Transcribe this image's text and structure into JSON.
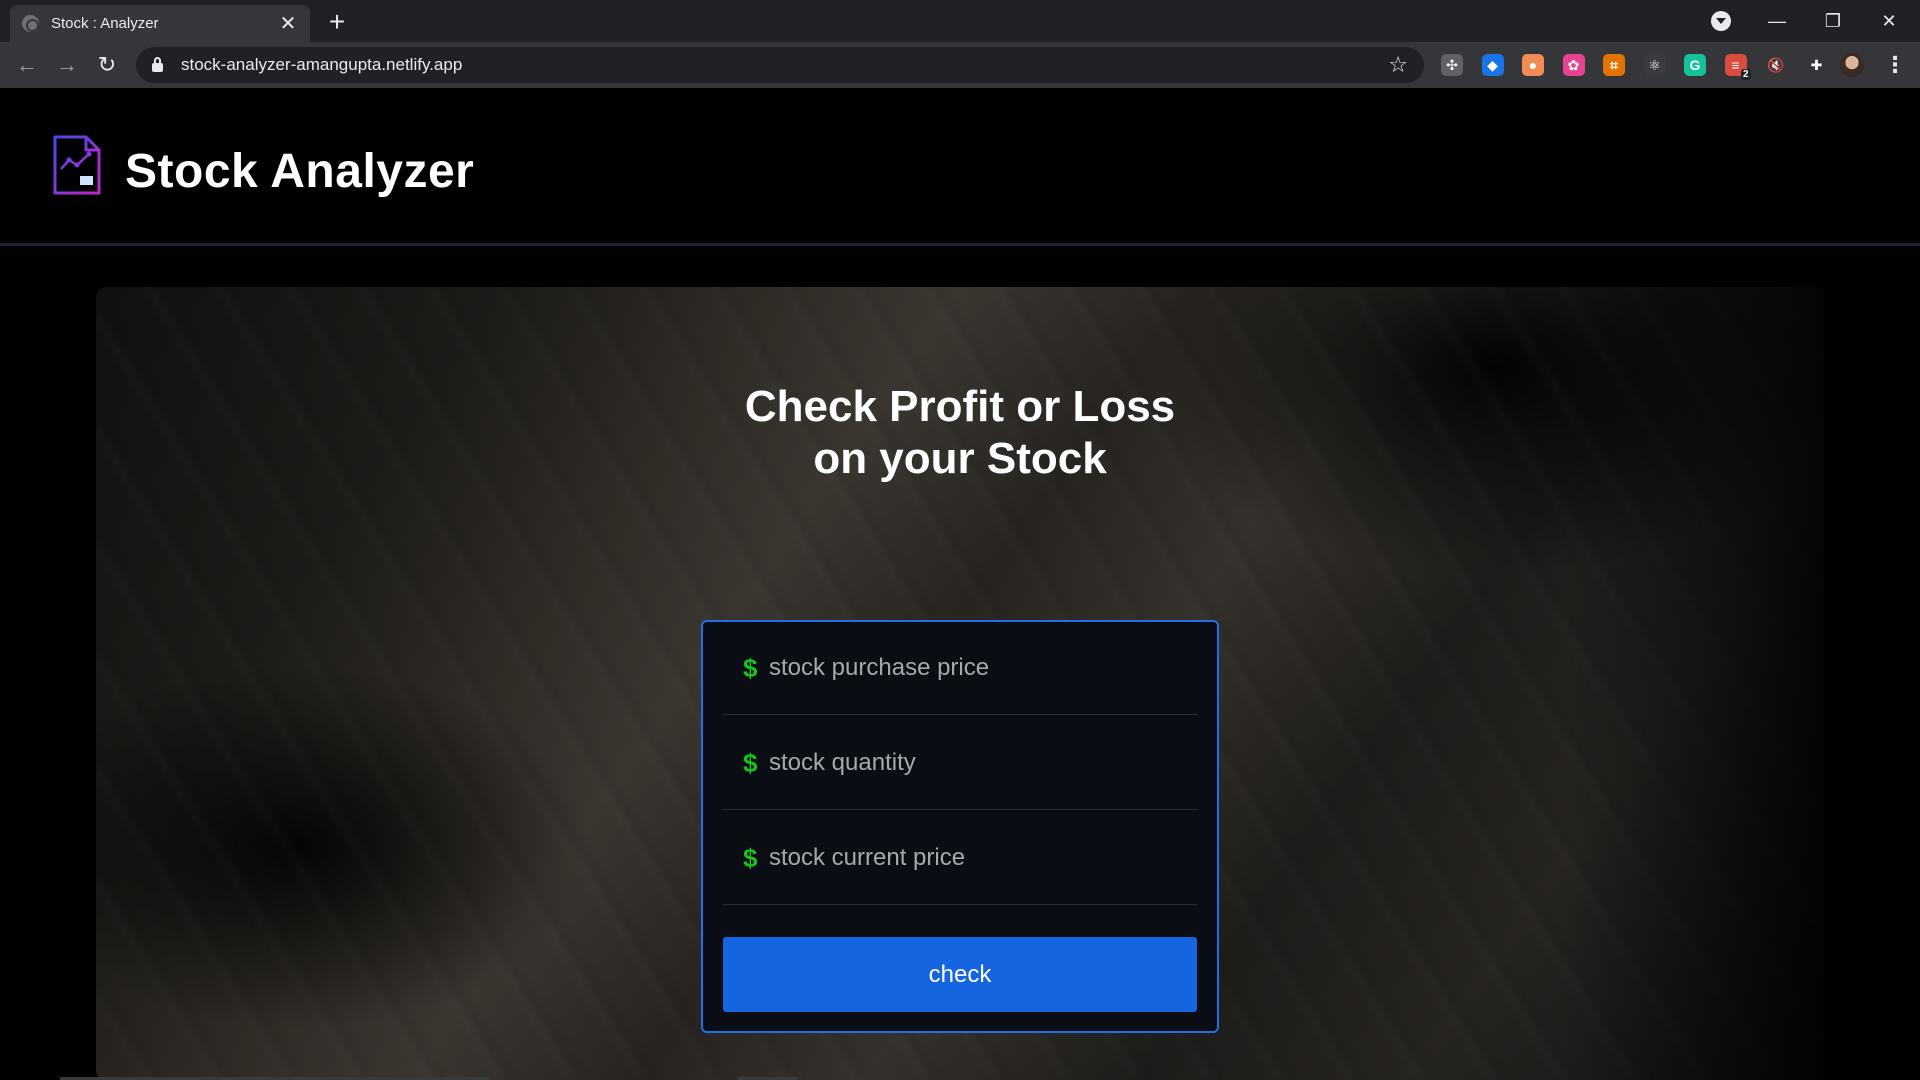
{
  "browser": {
    "tab_title": "Stock : Analyzer",
    "tab_close": "✕",
    "new_tab": "+",
    "url": "stock-analyzer-amangupta.netlify.app",
    "nav": {
      "back": "←",
      "forward": "→",
      "reload": "↻"
    },
    "window": {
      "minimize": "—",
      "restore": "❐",
      "close": "✕"
    },
    "extensions": [
      {
        "name": "extension-grid-icon",
        "symbol": "✣",
        "color": "#5f6368"
      },
      {
        "name": "extension-droplet-icon",
        "symbol": "◆",
        "color": "#1a73e8"
      },
      {
        "name": "extension-pill-icon",
        "symbol": "●",
        "color": "#f28b54"
      },
      {
        "name": "extension-color-wheel-icon",
        "symbol": "✿",
        "color": "#e84393"
      },
      {
        "name": "extension-capture-icon",
        "symbol": "⌗",
        "color": "#e37400"
      },
      {
        "name": "extension-react-icon",
        "symbol": "⚛",
        "color": "#3a3b3f"
      },
      {
        "name": "extension-grammarly-icon",
        "symbol": "G",
        "color": "#15c39a"
      },
      {
        "name": "extension-todoist-icon",
        "symbol": "≡",
        "color": "#db4c3f",
        "badge": "2"
      },
      {
        "name": "extension-mute-icon",
        "symbol": "🔇",
        "color": "#35363a"
      },
      {
        "name": "extensions-puzzle-icon",
        "symbol": "✚",
        "color": "#35363a"
      }
    ],
    "bookmark_star": "☆",
    "menu": "⋮"
  },
  "site": {
    "title": "Stock Analyzer",
    "heading_line1": "Check Profit or Loss",
    "heading_line2": "on your Stock"
  },
  "form": {
    "fields": [
      {
        "placeholder": "stock purchase price",
        "value": ""
      },
      {
        "placeholder": "stock quantity",
        "value": ""
      },
      {
        "placeholder": "stock current price",
        "value": ""
      }
    ],
    "dollar_symbol": "$",
    "button_label": "check"
  },
  "colors": {
    "accent": "#1565e0",
    "card_border": "#1f6fe5",
    "dollar": "#17c21b",
    "logo_gradient_start": "#4f46e5",
    "logo_gradient_end": "#c026d3"
  }
}
